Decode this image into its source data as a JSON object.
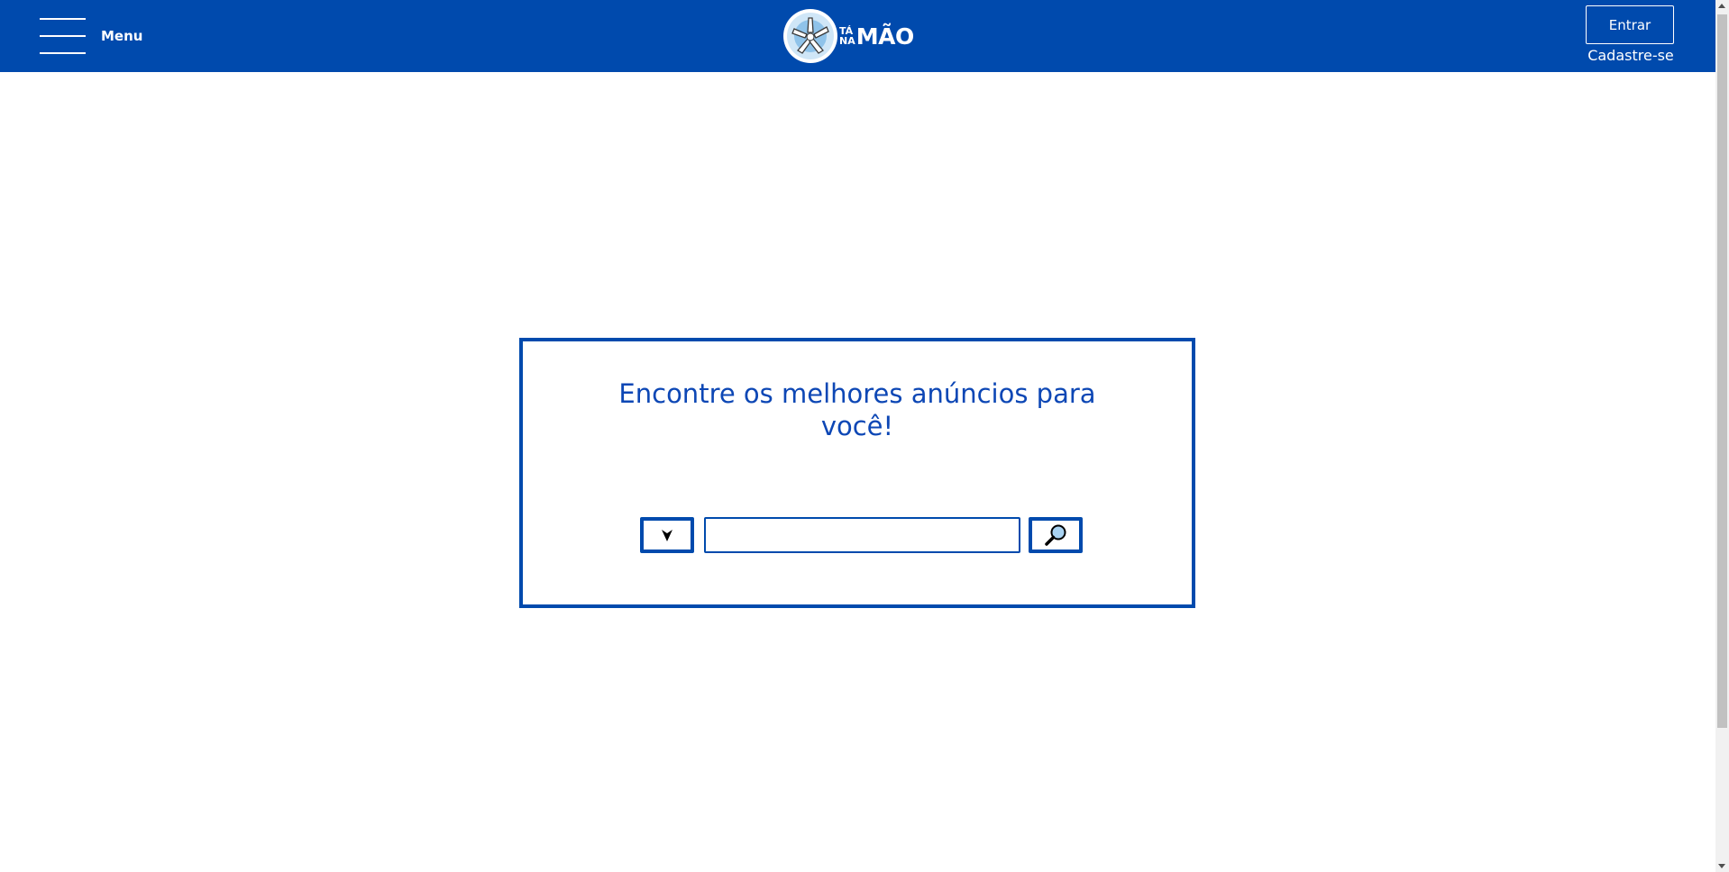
{
  "header": {
    "menu_label": "Menu",
    "logo": {
      "small_top": "TÁ",
      "small_bottom": "NA",
      "big": "MÃO"
    },
    "login_label": "Entrar",
    "signup_label": "Cadastre-se"
  },
  "search": {
    "title": "Encontre os melhores anúncios para você!",
    "input_value": "",
    "input_placeholder": "",
    "category_icon": "chevron-down-icon",
    "button_icon": "search-icon"
  },
  "colors": {
    "brand_blue": "#004aad",
    "title_blue": "#0d47b5",
    "background": "#ffffff"
  }
}
